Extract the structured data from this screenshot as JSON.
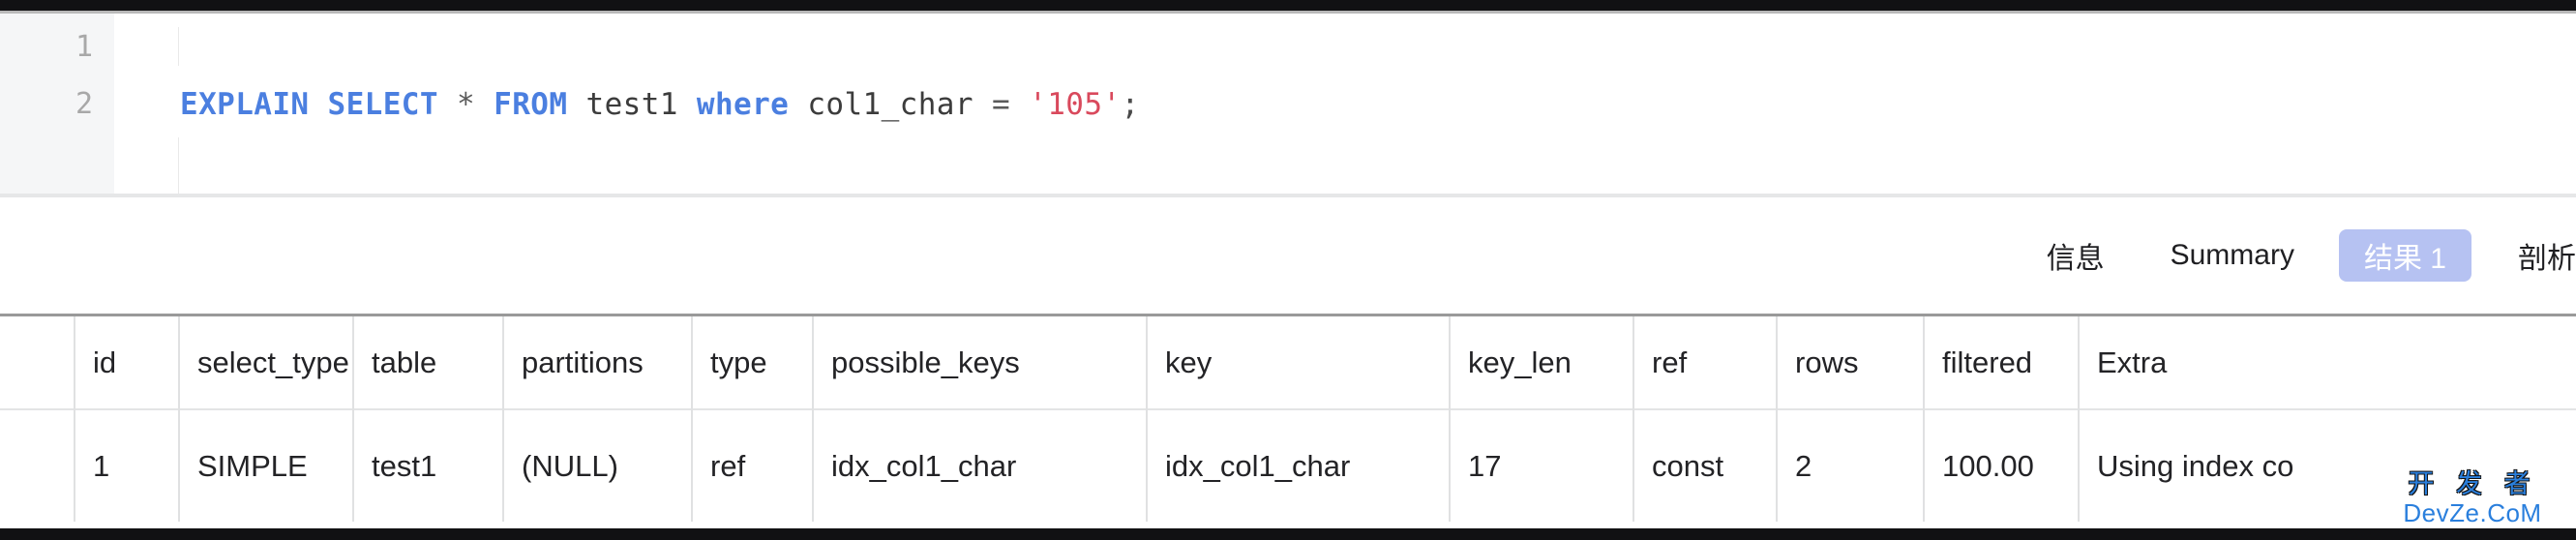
{
  "editor": {
    "line_numbers": [
      "1",
      "2"
    ],
    "line1": "",
    "sql": {
      "kw_explain": "EXPLAIN",
      "kw_select": "SELECT",
      "star": "*",
      "kw_from": "FROM",
      "table": "test1",
      "kw_where": "where",
      "column": "col1_char",
      "equals": "=",
      "value": "'105'",
      "semicolon": ";",
      "full_text": "EXPLAIN SELECT * FROM test1 where col1_char = '105';"
    }
  },
  "tabs": [
    {
      "label": "信息",
      "active": false
    },
    {
      "label": "Summary",
      "active": false
    },
    {
      "label": "结果 1",
      "active": true
    },
    {
      "label": "剖析",
      "active": false
    }
  ],
  "colors": {
    "keyword": "#4b7fe0",
    "string": "#d9495c",
    "active_tab_bg": "#b6c2f2",
    "active_tab_text": "#ffffff",
    "null_text": "#b7b8ba",
    "watermark": "#2a7fdd"
  },
  "result_table": {
    "columns": [
      "id",
      "select_type",
      "table",
      "partitions",
      "type",
      "possible_keys",
      "key",
      "key_len",
      "ref",
      "rows",
      "filtered",
      "Extra"
    ],
    "rows": [
      {
        "id": "1",
        "select_type": "SIMPLE",
        "table": "test1",
        "partitions": "(NULL)",
        "type": "ref",
        "possible_keys": "idx_col1_char",
        "key": "idx_col1_char",
        "key_len": "17",
        "ref": "const",
        "rows": "2",
        "filtered": "100.00",
        "extra": "Using index co"
      }
    ]
  },
  "watermark": {
    "cn": "开 发 者",
    "en": "DevZe.CoM"
  }
}
